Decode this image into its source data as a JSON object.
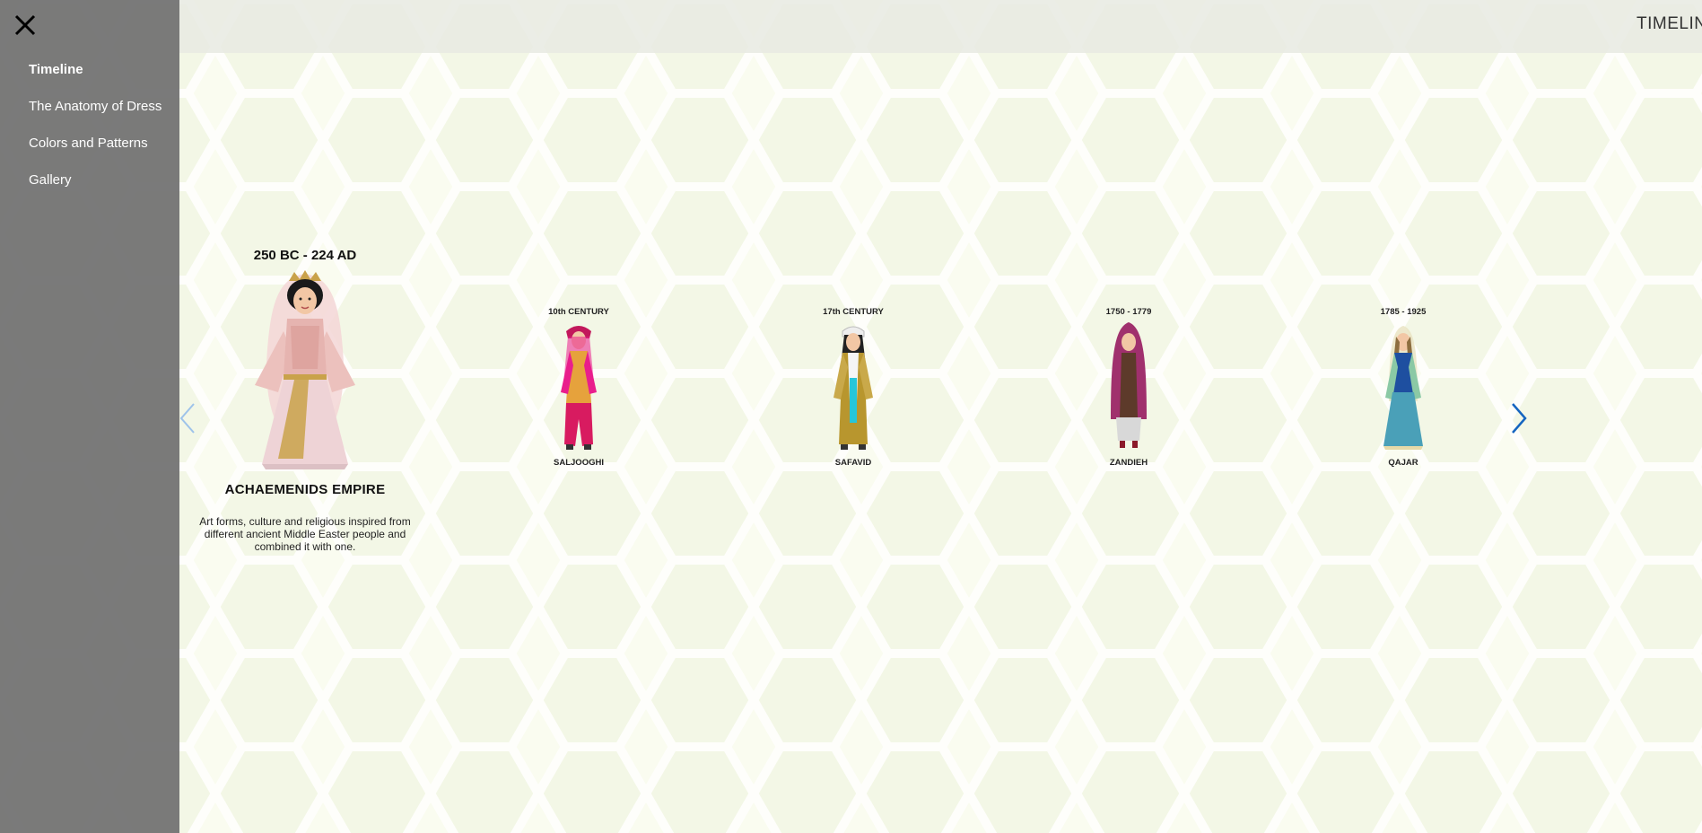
{
  "sidebar": {
    "close_icon": "close-icon",
    "items": [
      {
        "label": "Timeline",
        "active": true
      },
      {
        "label": "The Anatomy of Dress",
        "active": false
      },
      {
        "label": "Colors and Patterns",
        "active": false
      },
      {
        "label": "Gallery",
        "active": false
      }
    ]
  },
  "header": {
    "title": "TIMELINE"
  },
  "featured": {
    "date": "250 BC - 224 AD",
    "name": "ACHAEMENIDS EMPIRE",
    "description": "Art forms, culture and religious inspired from different ancient Middle Easter people and combined it with one."
  },
  "eras": [
    {
      "date": "10th CENTURY",
      "name": "SALJOOGHI"
    },
    {
      "date": "17th CENTURY",
      "name": "SAFAVID"
    },
    {
      "date": "1750 - 1779",
      "name": "ZANDIEH"
    },
    {
      "date": "1785 - 1925",
      "name": "QAJAR"
    }
  ],
  "navigation": {
    "prev_icon": "chevron-left-icon",
    "next_icon": "chevron-right-icon"
  },
  "colors": {
    "accent": "#1565c0",
    "sidebar": "#707070",
    "background": "#fafcf0"
  }
}
